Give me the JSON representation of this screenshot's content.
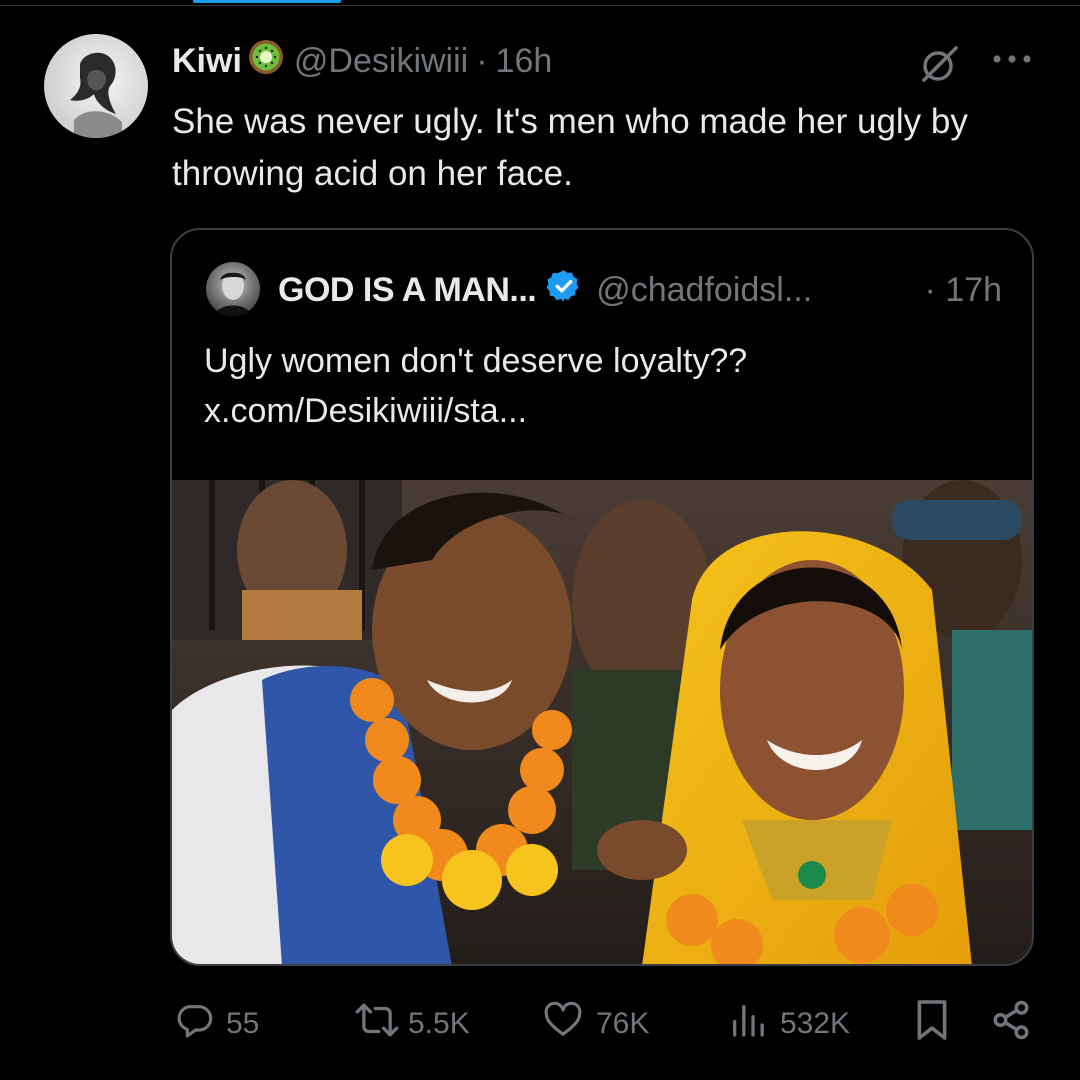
{
  "tweet": {
    "author_name": "Kiwi",
    "author_handle": "@Desikiwiii",
    "separator": "·",
    "time": "16h",
    "text": "She was never ugly. It's men who made her ugly by throwing acid on her face."
  },
  "quoted_tweet": {
    "author_name": "GOD IS A MAN...",
    "author_handle": "@chadfoidsl...",
    "time": "· 17h",
    "text_line1": "Ugly women don't deserve loyalty??",
    "text_line2": "x.com/Desikiwiii/sta..."
  },
  "actions": {
    "replies": "55",
    "reposts": "5.5K",
    "likes": "76K",
    "views": "532K"
  },
  "colors": {
    "background": "#000000",
    "text_primary": "#e7e9ea",
    "text_secondary": "#71767b",
    "accent_blue": "#1d9bf0",
    "kiwi_green": "#6cbf3a"
  },
  "icons": [
    "kiwi-icon",
    "grok-icon",
    "more-icon",
    "verified-icon",
    "reply-icon",
    "repost-icon",
    "like-icon",
    "views-icon",
    "bookmark-icon",
    "share-icon"
  ]
}
